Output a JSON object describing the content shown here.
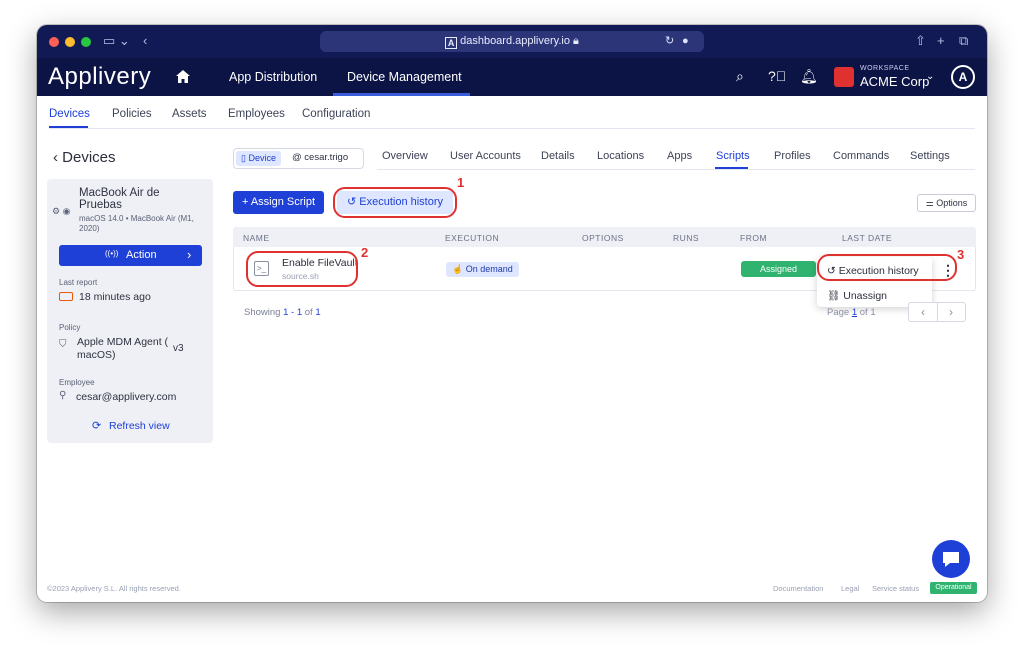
{
  "browser": {
    "url": "dashboard.applivery.io"
  },
  "header": {
    "logo": "Applivery",
    "nav": [
      "App Distribution",
      "Device Management"
    ],
    "workspace_label": "WORKSPACE",
    "workspace_name": "ACME Corp"
  },
  "subnav": {
    "items": [
      "Devices",
      "Policies",
      "Assets",
      "Employees",
      "Configuration"
    ]
  },
  "sidebar": {
    "back_title": "Devices",
    "device_name_1": "MacBook Air de",
    "device_name_2": "Pruebas",
    "device_info_1": "macOS 14.0 • MacBook Air (M1,",
    "device_info_2": "2020)",
    "action_label": "Action",
    "last_report_label": "Last report",
    "last_report_value": "18 minutes ago",
    "policy_label": "Policy",
    "policy_name_1": "Apple MDM Agent (",
    "policy_name_2": "macOS)",
    "policy_version": "v3",
    "employee_label": "Employee",
    "employee_email": "cesar@applivery.com",
    "refresh_label": "Refresh view"
  },
  "device_pill": {
    "type": "Device",
    "user": "cesar.trigo"
  },
  "tabs": [
    "Overview",
    "User Accounts",
    "Details",
    "Locations",
    "Apps",
    "Scripts",
    "Profiles",
    "Commands",
    "Settings"
  ],
  "toolbar": {
    "assign_label": "Assign Script",
    "history_label": "Execution history",
    "options_label": "Options"
  },
  "table": {
    "columns": [
      "NAME",
      "EXECUTION",
      "OPTIONS",
      "RUNS",
      "FROM",
      "LAST DATE"
    ],
    "rows": [
      {
        "name": "Enable FileVault",
        "file": "source.sh",
        "execution": "On demand",
        "from": "Assigned"
      }
    ]
  },
  "menu": {
    "history_label": "Execution history",
    "unassign_label": "Unassign"
  },
  "pagination": {
    "showing_prefix": "Showing",
    "range": "1 - 1",
    "of_label": "of",
    "total": "1",
    "page_label": "Page",
    "page": "1",
    "of_pages": "of 1"
  },
  "annotations": [
    "1",
    "2",
    "3"
  ],
  "footer": {
    "copyright": "©2023 Applivery S.L. All rights reserved.",
    "links": [
      "Documentation",
      "Legal",
      "Service status"
    ],
    "status": "Operational"
  },
  "colors": {
    "primary": "#1e40d6",
    "header_bg": "#0c1445",
    "success": "#2fb36f",
    "annotation": "#e03131"
  }
}
